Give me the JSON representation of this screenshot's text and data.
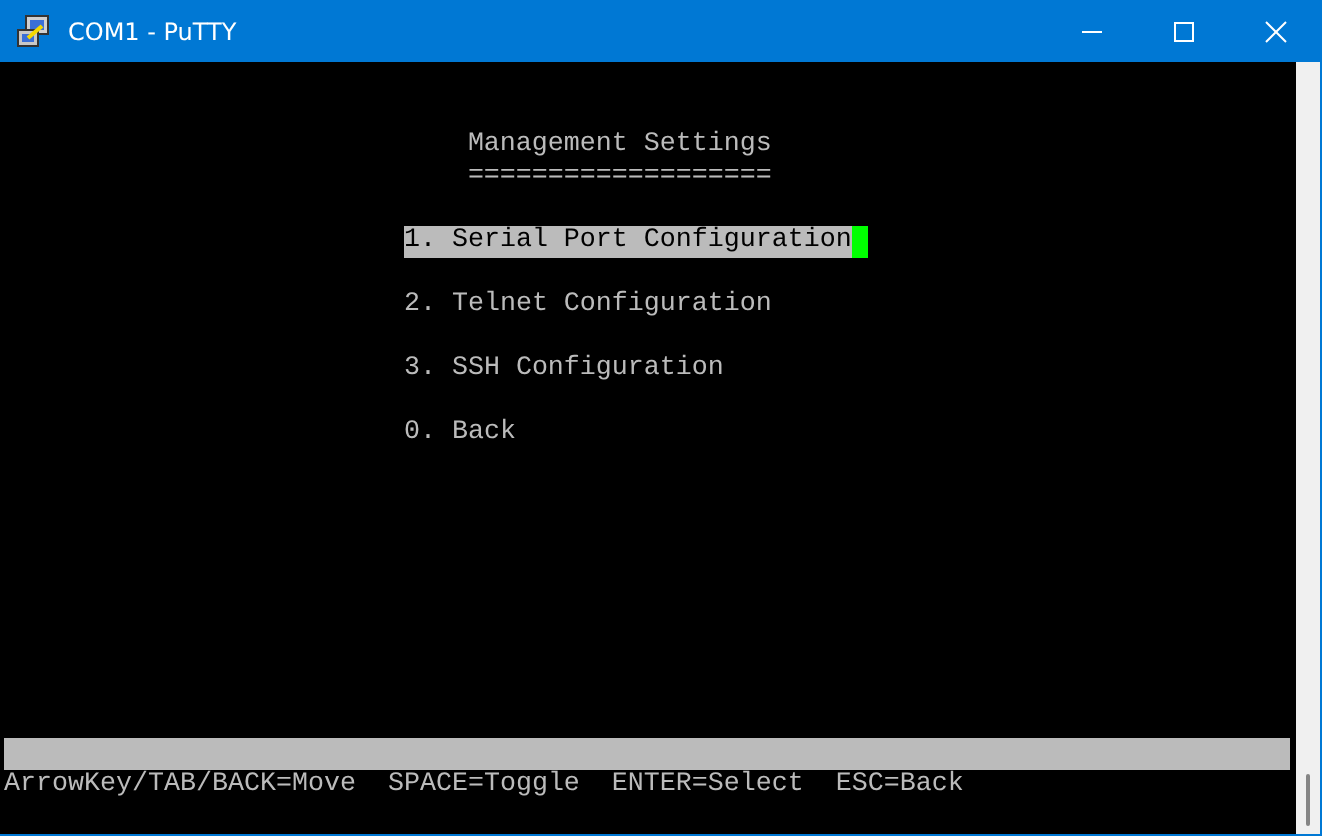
{
  "window": {
    "title": "COM1 - PuTTY"
  },
  "terminal": {
    "heading": "Management Settings",
    "underline": "===================",
    "menu": [
      {
        "label": "1. Serial Port Configuration",
        "selected": true
      },
      {
        "label": "2. Telnet Configuration",
        "selected": false
      },
      {
        "label": "3. SSH Configuration",
        "selected": false
      },
      {
        "label": "0. Back",
        "selected": false
      }
    ],
    "help_line": "ArrowKey/TAB/BACK=Move  SPACE=Toggle  ENTER=Select  ESC=Back"
  }
}
